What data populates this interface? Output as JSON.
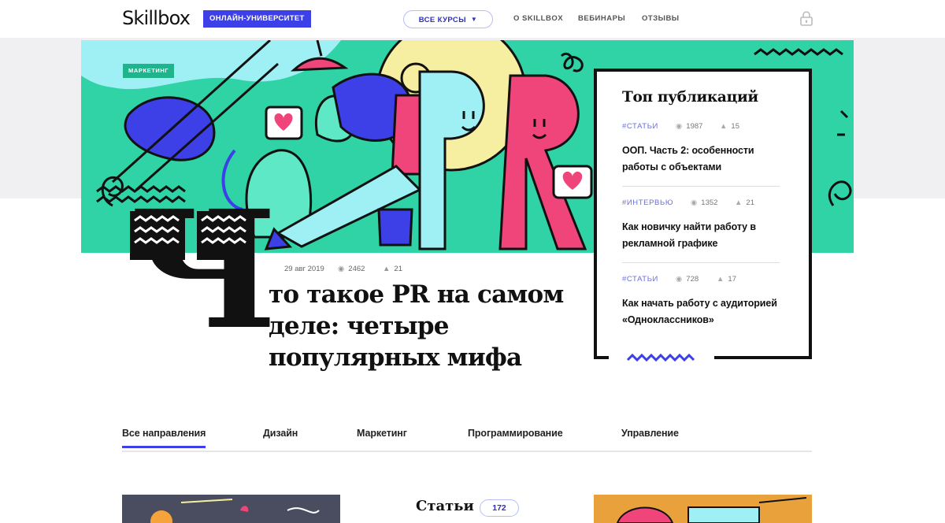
{
  "header": {
    "logo": "Skillbox",
    "badge": "ОНЛАЙН-УНИВЕРСИТЕТ",
    "courses_button": "ВСЕ КУРСЫ",
    "nav": [
      "О SKILLBOX",
      "ВЕБИНАРЫ",
      "ОТЗЫВЫ"
    ],
    "lock_icon": "lock-icon"
  },
  "hero": {
    "tag": "МАРКЕТИНГ",
    "illustration_text": "PR",
    "colors": {
      "background": "#2fd3a6",
      "pink": "#f0457a",
      "blue": "#3c40e6",
      "yellow": "#f6eea0",
      "light_blue": "#9ff0f5"
    }
  },
  "article": {
    "drop_cap": "Ч",
    "date": "29 авг 2019",
    "views": "2462",
    "likes": "21",
    "title": "то такое PR на самом деле: четыре популярных мифа"
  },
  "top_publications": {
    "title": "Топ публикаций",
    "items": [
      {
        "category": "#СТАТЬИ",
        "views": "1987",
        "likes": "15",
        "title": "ООП. Часть 2: особенности работы с объектами"
      },
      {
        "category": "#ИНТЕРВЬЮ",
        "views": "1352",
        "likes": "21",
        "title": "Как новичку найти работу в рекламной графике"
      },
      {
        "category": "#СТАТЬИ",
        "views": "728",
        "likes": "17",
        "title": "Как начать работу с аудиторией «Одноклассников»"
      }
    ]
  },
  "tabs": [
    "Все направления",
    "Дизайн",
    "Маркетинг",
    "Программирование",
    "Управление"
  ],
  "active_tab": "Все направления",
  "articles_section": {
    "title": "Статьи",
    "count": "172"
  },
  "accent_color": "#3c40e6"
}
